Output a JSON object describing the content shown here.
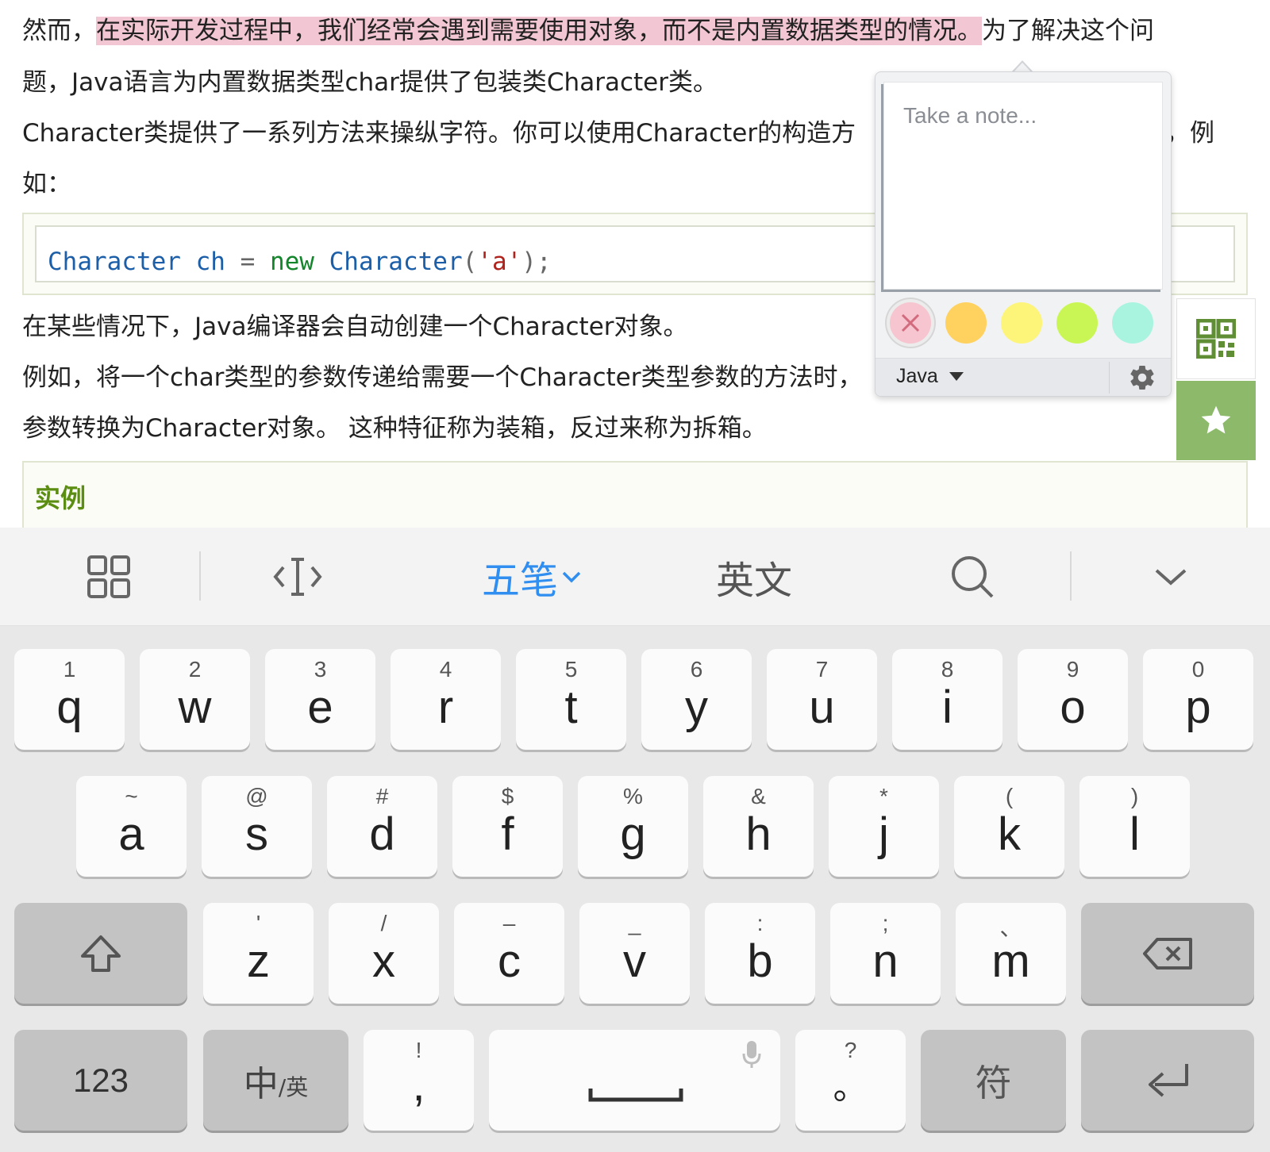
{
  "article": {
    "p1_pre": "然而，",
    "p1_highlight": "在实际开发过程中，我们经常会遇到需要使用对象，而不是内置数据类型的情况。",
    "p1_post": "为了解决这个问",
    "p2": "题，Java语言为内置数据类型char提供了包装类Character类。",
    "p3_left": "Character类提供了一系列方法来操纵字符。你可以使用Character的构造方",
    "p3_right": "，例",
    "p4": "如：",
    "code": {
      "t1": "Character",
      "t2": " ch ",
      "op": "=",
      "kw": " new ",
      "t3": "Character",
      "p1": "(",
      "str": "'a'",
      "p2": ");"
    },
    "p5": "在某些情况下，Java编译器会自动创建一个Character对象。",
    "p6": "例如，将一个char类型的参数传递给需要一个Character类型参数的方法时，",
    "p7": "参数转换为Character对象。 这种特征称为装箱，反过来称为拆箱。",
    "example_title": "实例"
  },
  "note_popup": {
    "placeholder": "Take a note...",
    "notebook": "Java",
    "colors": [
      "#f6c5cf",
      "#ffd15f",
      "#fdf47a",
      "#c9f654",
      "#a8f4df"
    ],
    "selected_color_index": 0
  },
  "keyboard": {
    "toolbar": {
      "input_mode": "五笔",
      "english": "英文"
    },
    "row1": [
      {
        "sub": "1",
        "main": "q"
      },
      {
        "sub": "2",
        "main": "w"
      },
      {
        "sub": "3",
        "main": "e"
      },
      {
        "sub": "4",
        "main": "r"
      },
      {
        "sub": "5",
        "main": "t"
      },
      {
        "sub": "6",
        "main": "y"
      },
      {
        "sub": "7",
        "main": "u"
      },
      {
        "sub": "8",
        "main": "i"
      },
      {
        "sub": "9",
        "main": "o"
      },
      {
        "sub": "0",
        "main": "p"
      }
    ],
    "row2": [
      {
        "sub": "~",
        "main": "a"
      },
      {
        "sub": "@",
        "main": "s"
      },
      {
        "sub": "#",
        "main": "d"
      },
      {
        "sub": "$",
        "main": "f"
      },
      {
        "sub": "%",
        "main": "g"
      },
      {
        "sub": "&",
        "main": "h"
      },
      {
        "sub": "*",
        "main": "j"
      },
      {
        "sub": "(",
        "main": "k"
      },
      {
        "sub": ")",
        "main": "l"
      }
    ],
    "row3": [
      {
        "sub": "'",
        "main": "z"
      },
      {
        "sub": "/",
        "main": "x"
      },
      {
        "sub": "–",
        "main": "c"
      },
      {
        "sub": "_",
        "main": "v"
      },
      {
        "sub": ":",
        "main": "b"
      },
      {
        "sub": ";",
        "main": "n"
      },
      {
        "sub": "、",
        "main": "m"
      }
    ],
    "bottom": {
      "num_label": "123",
      "lang_main": "中",
      "lang_sub": "/英",
      "comma_sub": "!",
      "comma_main": ",",
      "period_sub": "?",
      "period_main": "。",
      "symbols_label": "符"
    }
  }
}
